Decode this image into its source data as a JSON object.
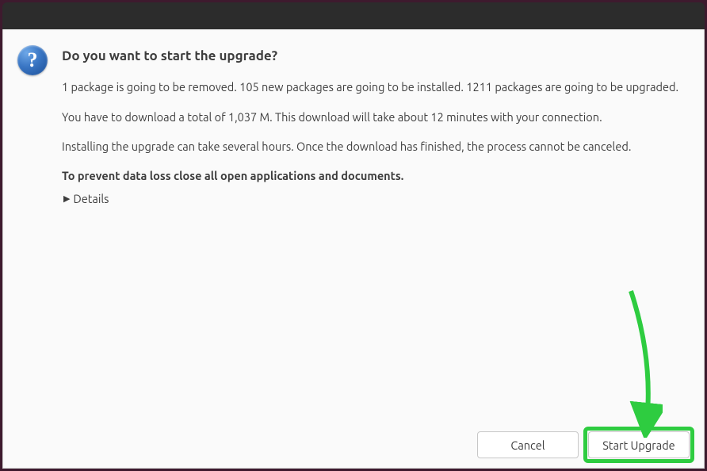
{
  "dialog": {
    "heading": "Do you want to start the upgrade?",
    "line1": "1 package is going to be removed. 105 new packages are going to be installed. 1211 packages are going to be upgraded.",
    "line2": "You have to download a total of 1,037 M. This download will take about 12 minutes with your connection.",
    "line3": "Installing the upgrade can take several hours. Once the download has finished, the process cannot be canceled.",
    "line4_bold": "To prevent data loss close all open applications and documents.",
    "details_label": "Details"
  },
  "buttons": {
    "cancel": "Cancel",
    "start_upgrade": "Start Upgrade"
  }
}
